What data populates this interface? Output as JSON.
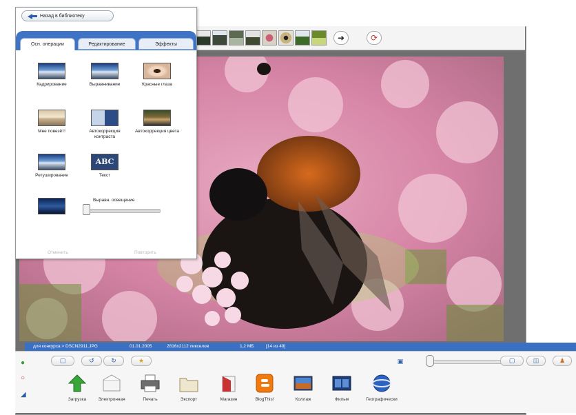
{
  "panel": {
    "back_label": "Назад в библиотеку",
    "tabs": [
      "Осн. операции",
      "Редактирование",
      "Эффекты"
    ],
    "tools": [
      {
        "label": "Кадрирование"
      },
      {
        "label": "Выравнивание"
      },
      {
        "label": "Красные глаза"
      },
      {
        "label": "Мне повезёт!"
      },
      {
        "label": "Автокоррекция контраста"
      },
      {
        "label": "Автокоррекция цвета"
      },
      {
        "label": "Ретуширование"
      },
      {
        "label": "Текст"
      }
    ],
    "light_label": "Выравн. освещение",
    "light_value": 0,
    "undo_label": "Отменить",
    "redo_label": "Повторить",
    "text_icon_label": "ABC"
  },
  "status": {
    "path": "для конкурса > DSCN2911.JPG",
    "date": "01.01.2005",
    "size": "2816x2112 пикселов",
    "filesize": "1,2 МБ",
    "counter": "[14 из 49]",
    "accent": "#3a70c4"
  },
  "bottom": {
    "actions": [
      {
        "label": "Загрузка",
        "icon": "upload-arrow-icon"
      },
      {
        "label": "Электронная",
        "icon": "envelope-icon"
      },
      {
        "label": "Печать",
        "icon": "printer-icon"
      },
      {
        "label": "Экспорт",
        "icon": "folder-icon"
      },
      {
        "label": "Магазин",
        "icon": "shop-icon"
      },
      {
        "label": "BlogThis!",
        "icon": "blogger-icon"
      },
      {
        "label": "Коллаж",
        "icon": "collage-icon"
      },
      {
        "label": "Фильм",
        "icon": "film-icon"
      },
      {
        "label": "Географически",
        "icon": "globe-icon"
      }
    ],
    "zoom_value": 0
  }
}
